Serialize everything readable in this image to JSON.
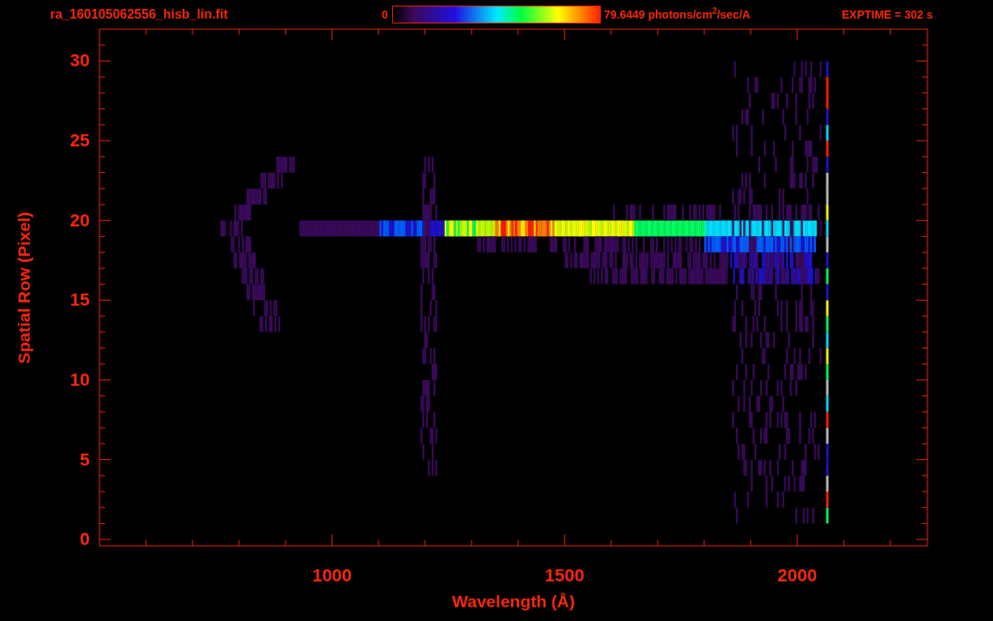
{
  "title": "ra_160105062556_hisb_lin.fit",
  "colorbar": {
    "min_label": "0",
    "max_label": "79.6449 photons/cm$^{2}$/sec/A"
  },
  "exposure": "EXPTIME = 302 s",
  "plot": {
    "ylabel": "Spatial Row (Pixel)",
    "yticks": [
      "30",
      "25",
      "20",
      "15",
      "10",
      "5",
      "0"
    ],
    "xticks": [
      "1000",
      "1500",
      "2000"
    ],
    "xlabel": "Wavelength (Å)"
  }
}
